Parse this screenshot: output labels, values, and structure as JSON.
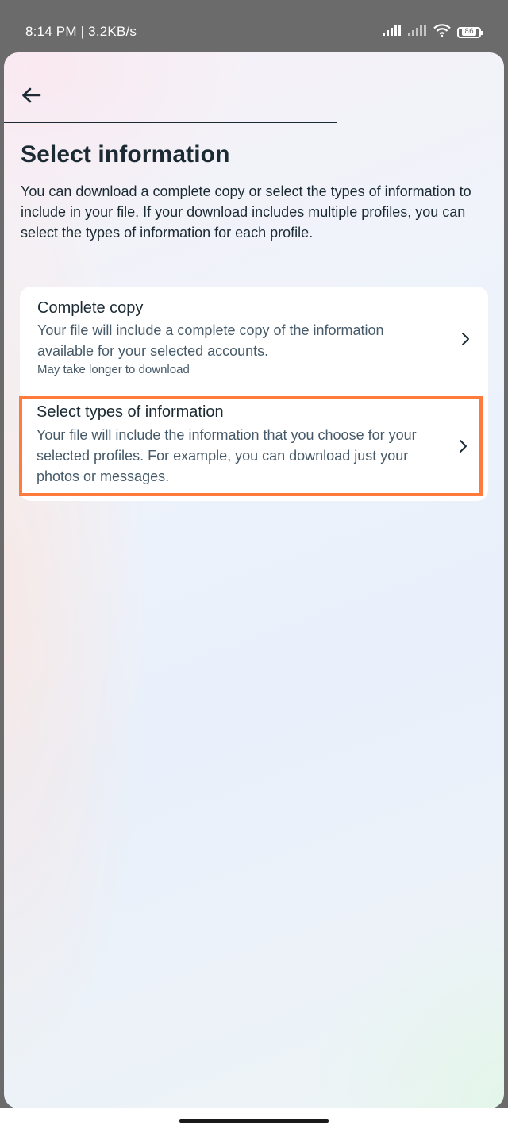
{
  "status_bar": {
    "time": "8:14 PM | 3.2KB/s",
    "battery": "86"
  },
  "header": {
    "back_icon": "arrow-left-icon"
  },
  "page": {
    "title": "Select information",
    "description": "You can download a complete copy or select the types of information to include in your file. If your download includes multiple profiles, you can select the types of information for each profile."
  },
  "options": [
    {
      "title": "Complete copy",
      "description": "Your file will include a complete copy of the information available for your selected accounts.",
      "note": "May take longer to download",
      "icon": "chevron-right-icon"
    },
    {
      "title": "Select types of information",
      "description": "Your file will include the information that you choose for your selected profiles. For example, you can download just your photos or messages.",
      "icon": "chevron-right-icon",
      "highlighted": true
    }
  ],
  "colors": {
    "text_primary": "#1c2b33",
    "text_secondary": "#465a69",
    "highlight_border": "#ff7a3d",
    "status_bar_bg": "#6b6b6b"
  }
}
